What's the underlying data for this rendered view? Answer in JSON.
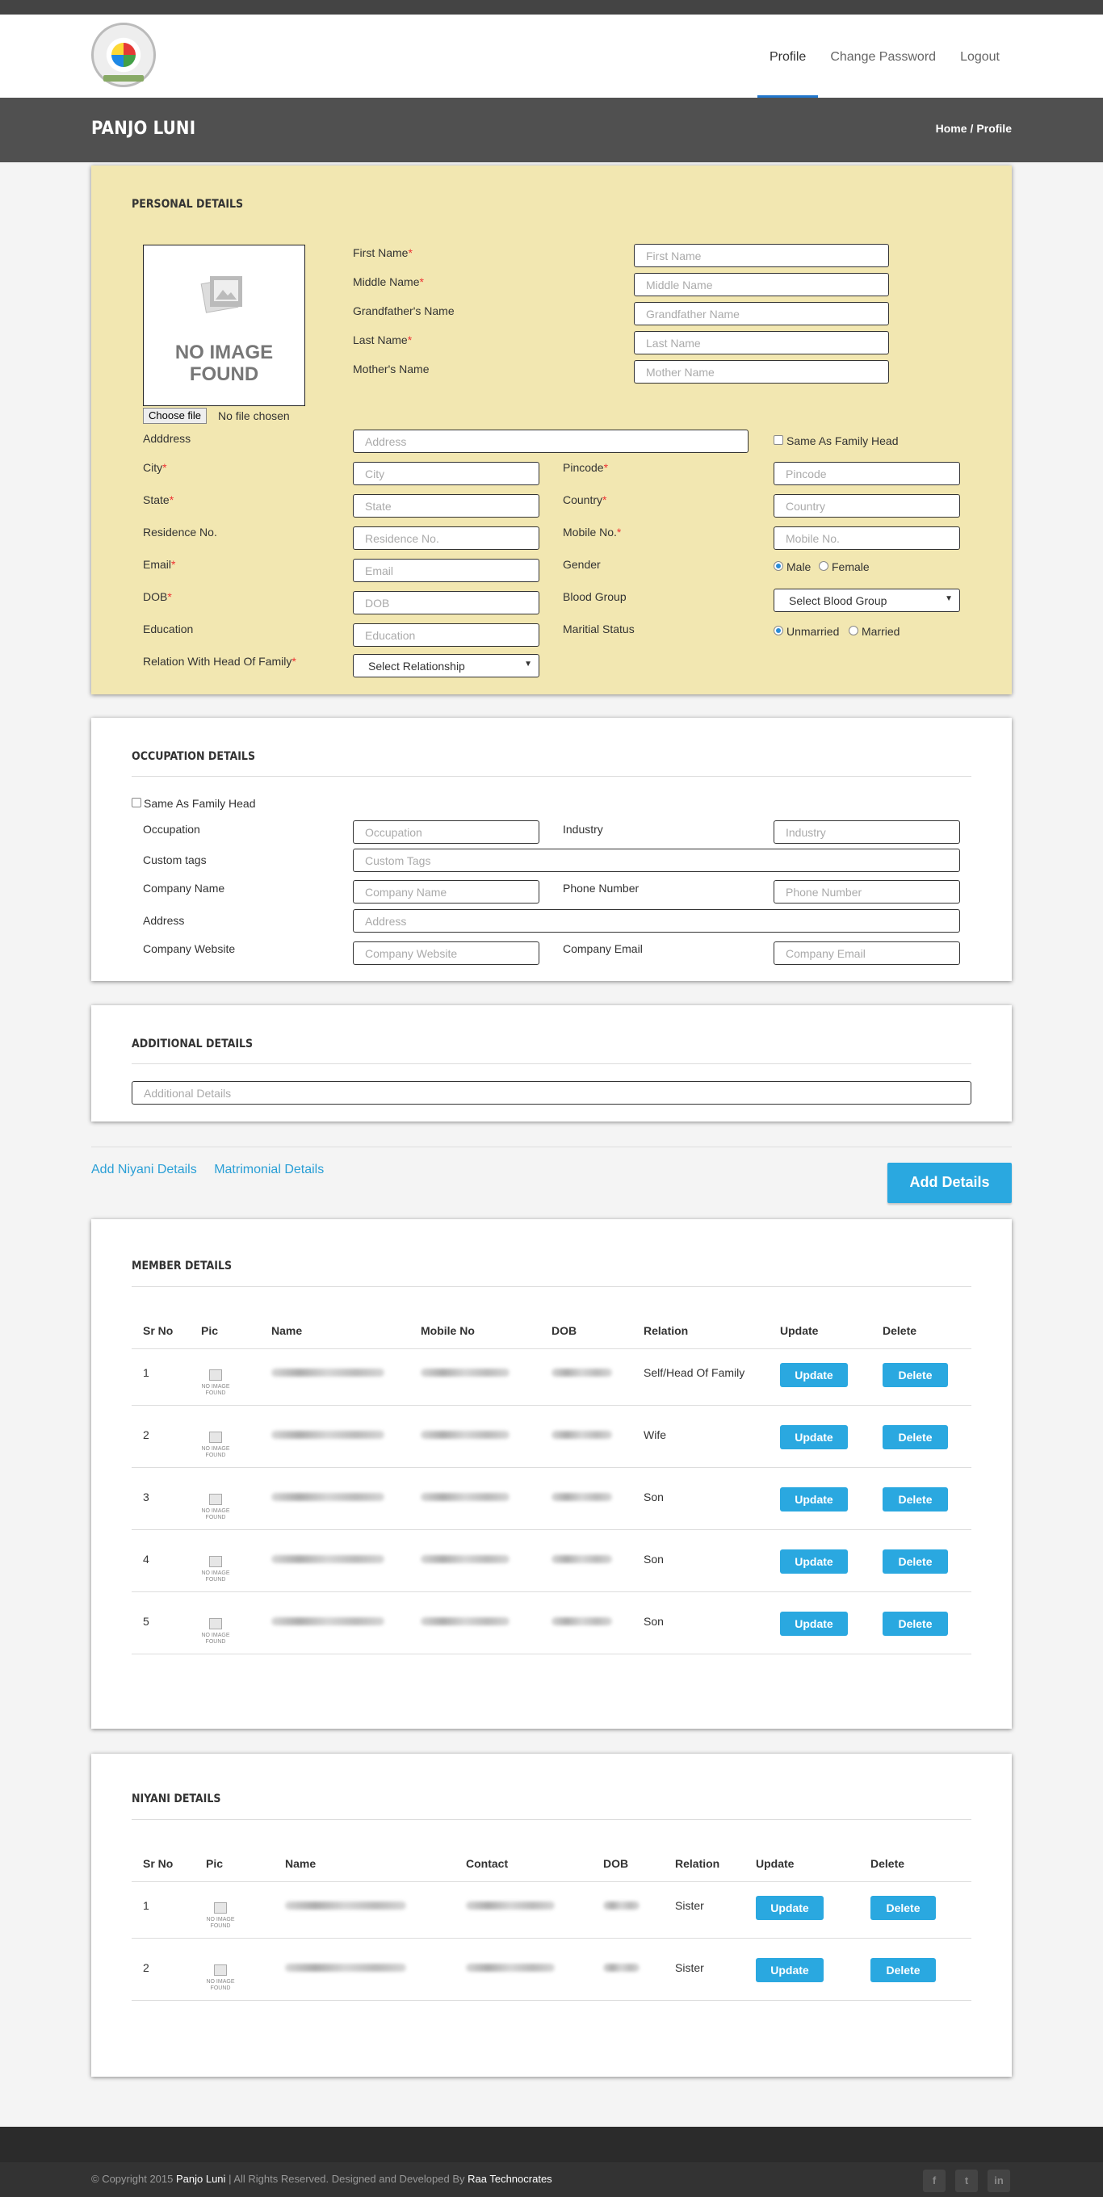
{
  "nav": {
    "profile": "Profile",
    "change_password": "Change Password",
    "logout": "Logout"
  },
  "page": {
    "title": "PANJO LUNI",
    "crumb_home": "Home",
    "crumb_sep": "/",
    "crumb_current": "Profile"
  },
  "personal": {
    "title": "PERSONAL DETAILS",
    "no_image_line1": "NO IMAGE",
    "no_image_line2": "FOUND",
    "choose_file": "Choose file",
    "no_file": "No file chosen",
    "first_name": {
      "label": "First Name",
      "placeholder": "First Name"
    },
    "middle_name": {
      "label": "Middle Name",
      "placeholder": "Middle Name"
    },
    "grandfather_name": {
      "label": "Grandfather's Name",
      "placeholder": "Grandfather Name"
    },
    "last_name": {
      "label": "Last Name",
      "placeholder": "Last Name"
    },
    "mother_name": {
      "label": "Mother's Name",
      "placeholder": "Mother Name"
    },
    "address": {
      "label": "Adddress",
      "placeholder": "Address"
    },
    "same_as_head": "Same As Family Head",
    "city": {
      "label": "City",
      "placeholder": "City"
    },
    "pincode": {
      "label": "Pincode",
      "placeholder": "Pincode"
    },
    "state": {
      "label": "State",
      "placeholder": "State"
    },
    "country": {
      "label": "Country",
      "placeholder": "Country"
    },
    "residence": {
      "label": "Residence No.",
      "placeholder": "Residence No."
    },
    "mobile": {
      "label": "Mobile No.",
      "placeholder": "Mobile No."
    },
    "email": {
      "label": "Email",
      "placeholder": "Email"
    },
    "gender": {
      "label": "Gender",
      "male": "Male",
      "female": "Female"
    },
    "dob": {
      "label": "DOB",
      "placeholder": "DOB"
    },
    "blood_group": {
      "label": "Blood Group",
      "value": "Select Blood Group"
    },
    "education": {
      "label": "Education",
      "placeholder": "Education"
    },
    "marital": {
      "label": "Maritial Status",
      "unmarried": "Unmarried",
      "married": "Married"
    },
    "relation": {
      "label": "Relation With Head Of Family",
      "value": "Select Relationship"
    },
    "required_mark": "*"
  },
  "occupation": {
    "title": "OCCUPATION DETAILS",
    "same_as_head": "Same As Family Head",
    "occupation": {
      "label": "Occupation",
      "placeholder": "Occupation"
    },
    "industry": {
      "label": "Industry",
      "placeholder": "Industry"
    },
    "custom_tags": {
      "label": "Custom tags",
      "placeholder": "Custom Tags"
    },
    "company_name": {
      "label": "Company Name",
      "placeholder": "Company Name"
    },
    "phone": {
      "label": "Phone Number",
      "placeholder": "Phone Number"
    },
    "address": {
      "label": "Address",
      "placeholder": "Address"
    },
    "website": {
      "label": "Company Website",
      "placeholder": "Company Website"
    },
    "company_email": {
      "label": "Company Email",
      "placeholder": "Company Email"
    }
  },
  "additional": {
    "title": "ADDITIONAL DETAILS",
    "placeholder": "Additional Details"
  },
  "links": {
    "niyani": "Add Niyani Details",
    "matrimonial": "Matrimonial Details",
    "add_details": "Add Details"
  },
  "members": {
    "title": "MEMBER DETAILS",
    "headers": [
      "Sr No",
      "Pic",
      "Name",
      "Mobile No",
      "DOB",
      "Relation",
      "Update",
      "Delete"
    ],
    "rows": [
      {
        "sr": "1",
        "relation": "Self/Head Of Family"
      },
      {
        "sr": "2",
        "relation": "Wife"
      },
      {
        "sr": "3",
        "relation": "Son"
      },
      {
        "sr": "4",
        "relation": "Son"
      },
      {
        "sr": "5",
        "relation": "Son"
      }
    ],
    "update_label": "Update",
    "delete_label": "Delete",
    "thumb_text": "NO IMAGE FOUND"
  },
  "niyani": {
    "title": "NIYANI DETAILS",
    "headers": [
      "Sr No",
      "Pic",
      "Name",
      "Contact",
      "DOB",
      "Relation",
      "Update",
      "Delete"
    ],
    "rows": [
      {
        "sr": "1",
        "relation": "Sister"
      },
      {
        "sr": "2",
        "relation": "Sister"
      }
    ],
    "update_label": "Update",
    "delete_label": "Delete",
    "thumb_text": "NO IMAGE FOUND"
  },
  "footer": {
    "prefix": "© Copyright 2015",
    "brand": "Panjo Luni",
    "middle": "| All Rights Reserved. Designed and Developed By",
    "developer": "Raa Technocrates",
    "social": [
      "f",
      "t",
      "in"
    ]
  }
}
